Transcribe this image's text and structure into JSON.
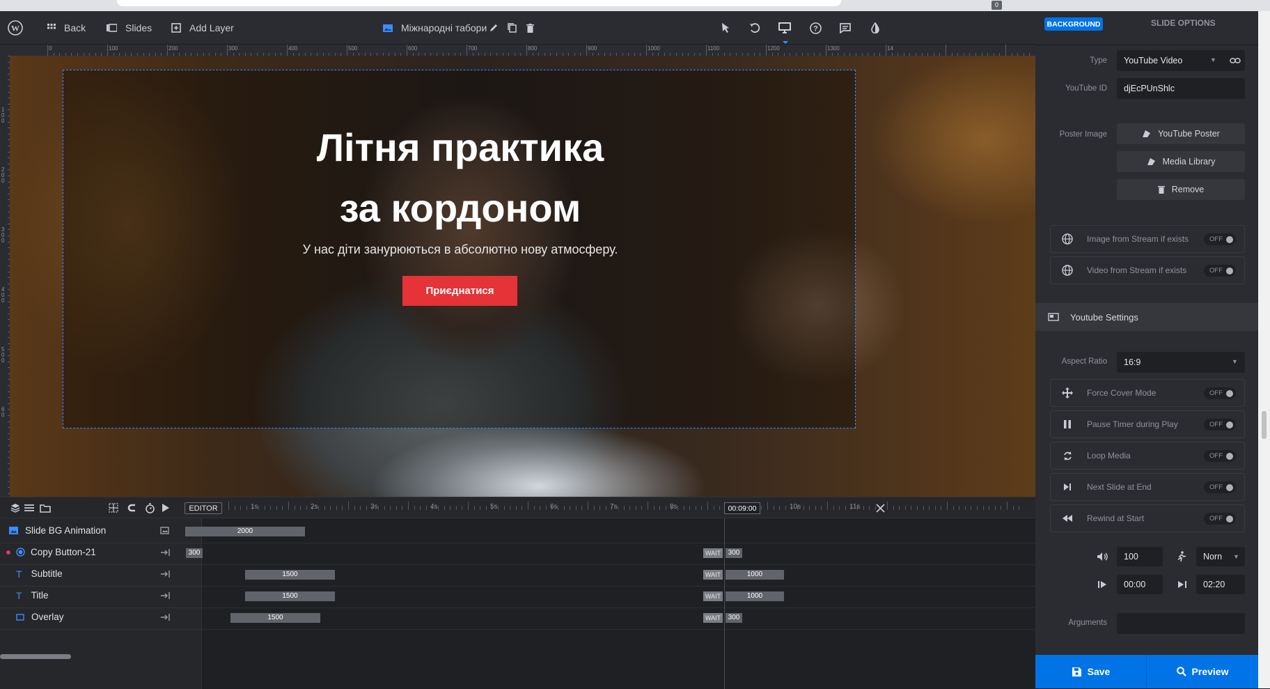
{
  "browser": {
    "tab_count": "0"
  },
  "topbar": {
    "back": "Back",
    "slides": "Slides",
    "add_layer": "Add Layer",
    "slide_title": "Міжнародні табори"
  },
  "ruler": {
    "h": [
      "0",
      "100",
      "200",
      "300",
      "400",
      "500",
      "600",
      "700",
      "800",
      "900",
      "1000",
      "1100",
      "1200",
      "1300",
      "14"
    ],
    "v": [
      "1\n0\n0",
      "2\n0\n0",
      "3\n0\n0",
      "4\n0\n0",
      "5\n0\n0",
      "6\n0"
    ]
  },
  "slide": {
    "title_line1": "Літня практика",
    "title_line2": "за кордоном",
    "subtitle": "У нас діти занурюються в абсолютно нову атмосферу.",
    "button": "Приєднатися"
  },
  "timeline": {
    "editor": "EDITOR",
    "time": "00:09:00",
    "ticks": [
      "1s",
      "2s",
      "3s",
      "4s",
      "5s",
      "6s",
      "7s",
      "8s",
      "9s",
      "10s",
      "11s"
    ],
    "rows": [
      {
        "name": "Slide BG Animation",
        "bar": "2000"
      },
      {
        "name": "Copy Button-21",
        "bar": "300",
        "wait": "WAIT",
        "end": "300"
      },
      {
        "name": "Subtitle",
        "bar": "1500",
        "wait": "WAIT",
        "end": "1000"
      },
      {
        "name": "Title",
        "bar": "1500",
        "wait": "WAIT",
        "end": "1000"
      },
      {
        "name": "Overlay",
        "bar": "1500",
        "wait": "WAIT",
        "end": "300"
      }
    ]
  },
  "panel": {
    "tab_background": "BACKGROUND",
    "tab_slide_options": "SLIDE OPTIONS",
    "type_label": "Type",
    "type_value": "YouTube Video",
    "ytid_label": "YouTube ID",
    "ytid_value": "djEcPUnShlc",
    "poster_label": "Poster Image",
    "poster_btn": "YouTube Poster",
    "media_btn": "Media Library",
    "remove_btn": "Remove",
    "img_stream": "Image from Stream if exists",
    "vid_stream": "Video from Stream if exists",
    "off": "OFF",
    "yt_settings": "Youtube Settings",
    "aspect_label": "Aspect Ratio",
    "aspect_value": "16:9",
    "force_cover": "Force Cover Mode",
    "pause_timer": "Pause Timer during Play",
    "loop_media": "Loop Media",
    "next_slide": "Next Slide at End",
    "rewind": "Rewind at Start",
    "volume": "100",
    "speed": "Norn",
    "start": "00:00",
    "end": "02:20",
    "arguments_label": "Arguments",
    "save": "Save",
    "preview": "Preview"
  },
  "colors": {
    "accent": "#0073e6",
    "cta": "#e53337"
  }
}
